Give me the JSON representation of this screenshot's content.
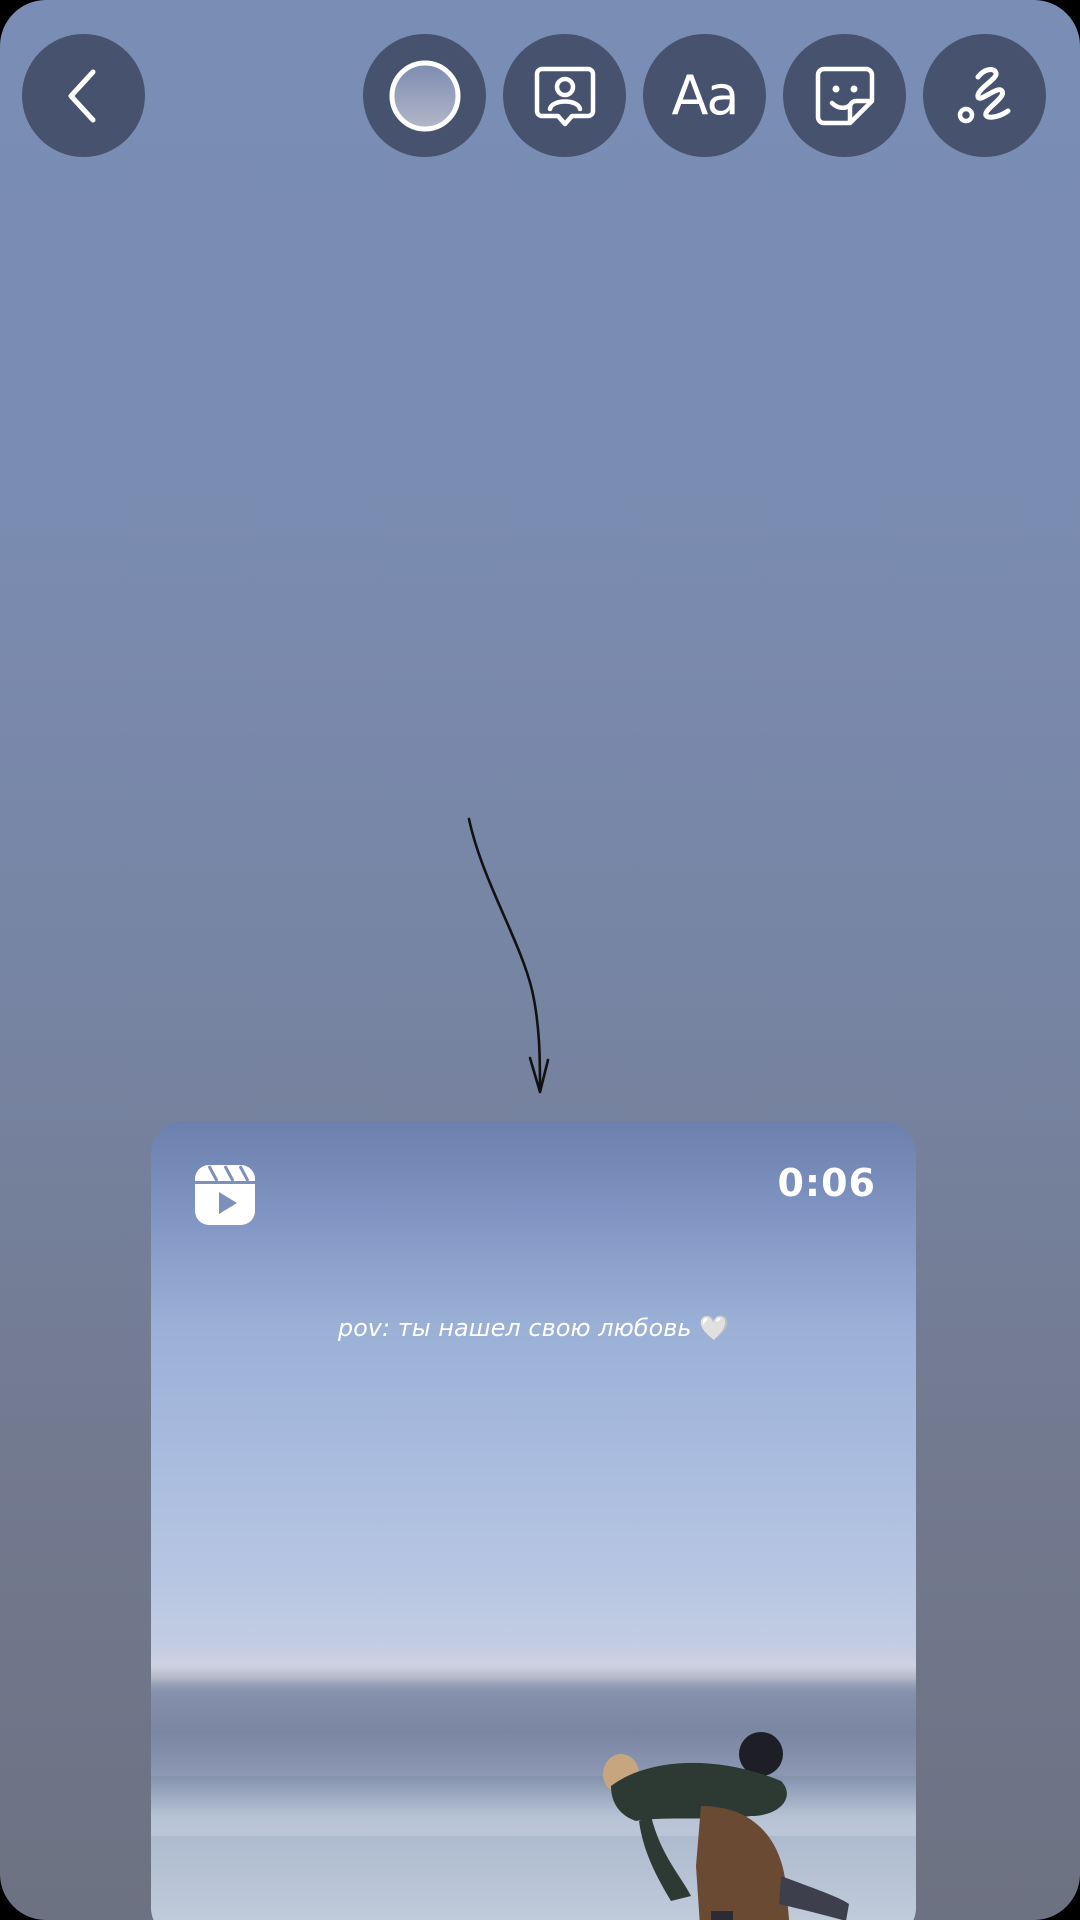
{
  "toolbar": {
    "back_icon": "chevron-left-icon",
    "text_label": "Aa",
    "tools": [
      "circle-icon",
      "portrait-icon",
      "text-icon",
      "sticker-icon",
      "draw-icon"
    ]
  },
  "reel_card": {
    "icon": "reels-icon",
    "duration": "0:06",
    "caption": "pov: ты нашел свою любовь",
    "caption_emoji": "🤍"
  },
  "colors": {
    "background": "#7889ab",
    "button": "#3c465f",
    "icon": "#ffffff"
  }
}
